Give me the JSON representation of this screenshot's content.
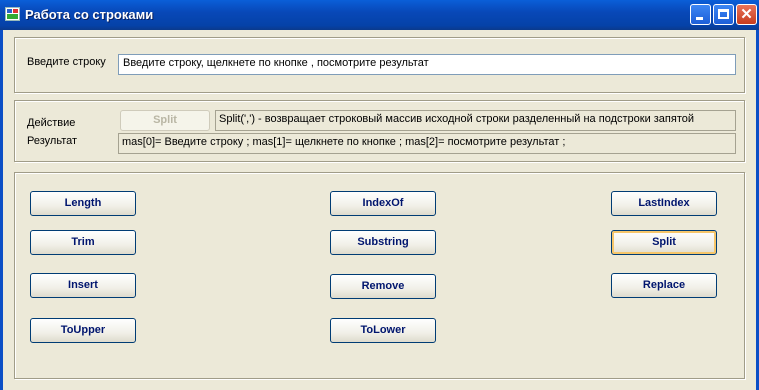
{
  "window": {
    "title": "Работа со строками",
    "close_glyph": "✕"
  },
  "input_group": {
    "label": "Введите строку",
    "value": "Введите строку, щелкнете по кнопке , посмотрите результат"
  },
  "action_group": {
    "action_label": "Действие",
    "result_label": "Результат",
    "action_button": "Split",
    "description": "Split(',') - возвращает строковый массив исходной строки разделенный на подстроки запятой",
    "result": "mas[0]= Введите строку  ; mas[1]=  щелкнете по кнопке   ; mas[2]=  посмотрите результат   ;"
  },
  "buttons": {
    "length": "Length",
    "indexof": "IndexOf",
    "lastindex": "LastIndex",
    "trim": "Trim",
    "substring": "Substring",
    "split": "Split",
    "insert": "Insert",
    "remove": "Remove",
    "replace": "Replace",
    "toupper": "ToUpper",
    "tolower": "ToLower"
  },
  "icons": {
    "app": "app-icon",
    "minimize": "minimize-icon",
    "maximize": "maximize-icon",
    "close": "close-icon"
  }
}
